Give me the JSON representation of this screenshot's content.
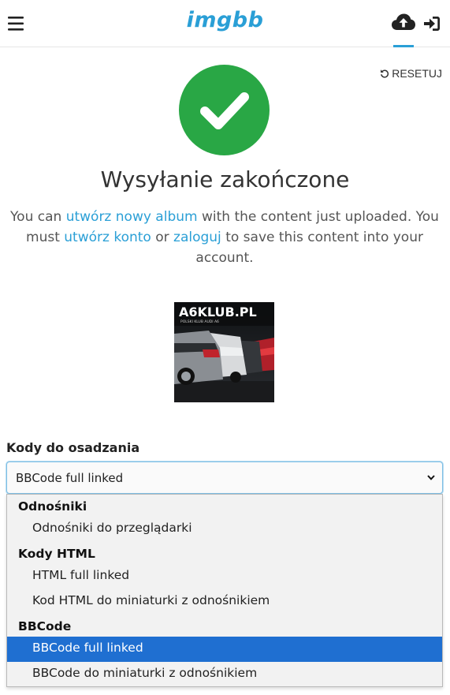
{
  "header": {
    "logo_text": "imgbb",
    "menu_icon": "hamburger-icon",
    "upload_icon": "cloud-upload-icon",
    "login_icon": "sign-in-icon",
    "accent_color": "#2a9fd6"
  },
  "reset": {
    "label": "RESETUJ",
    "icon": "undo-icon"
  },
  "status": {
    "icon": "check-icon",
    "color": "#29a745",
    "title": "Wysyłanie zakończone"
  },
  "message": {
    "part1": "You can ",
    "link_album": "utwórz nowy album",
    "part2": " with the content just uploaded. You must ",
    "link_account": "utwórz konto",
    "part3": " or ",
    "link_login": "zaloguj",
    "part4": " to save this content into your account."
  },
  "thumbnail": {
    "overlay_text": "A6KLUB.PL",
    "overlay_subtext": "POLSKI KLUB AUDI A6"
  },
  "embed": {
    "label": "Kody do osadzania",
    "selected": "BBCode full linked",
    "groups": [
      {
        "label": "Odnośniki",
        "options": [
          "Odnośniki do przeglądarki"
        ]
      },
      {
        "label": "Kody HTML",
        "options": [
          "HTML full linked",
          "Kod HTML do miniaturki z odnośnikiem"
        ]
      },
      {
        "label": "BBCode",
        "options": [
          "BBCode full linked",
          "BBCode do miniaturki z odnośnikiem"
        ]
      }
    ],
    "highlight_color": "#1f6fd1"
  }
}
